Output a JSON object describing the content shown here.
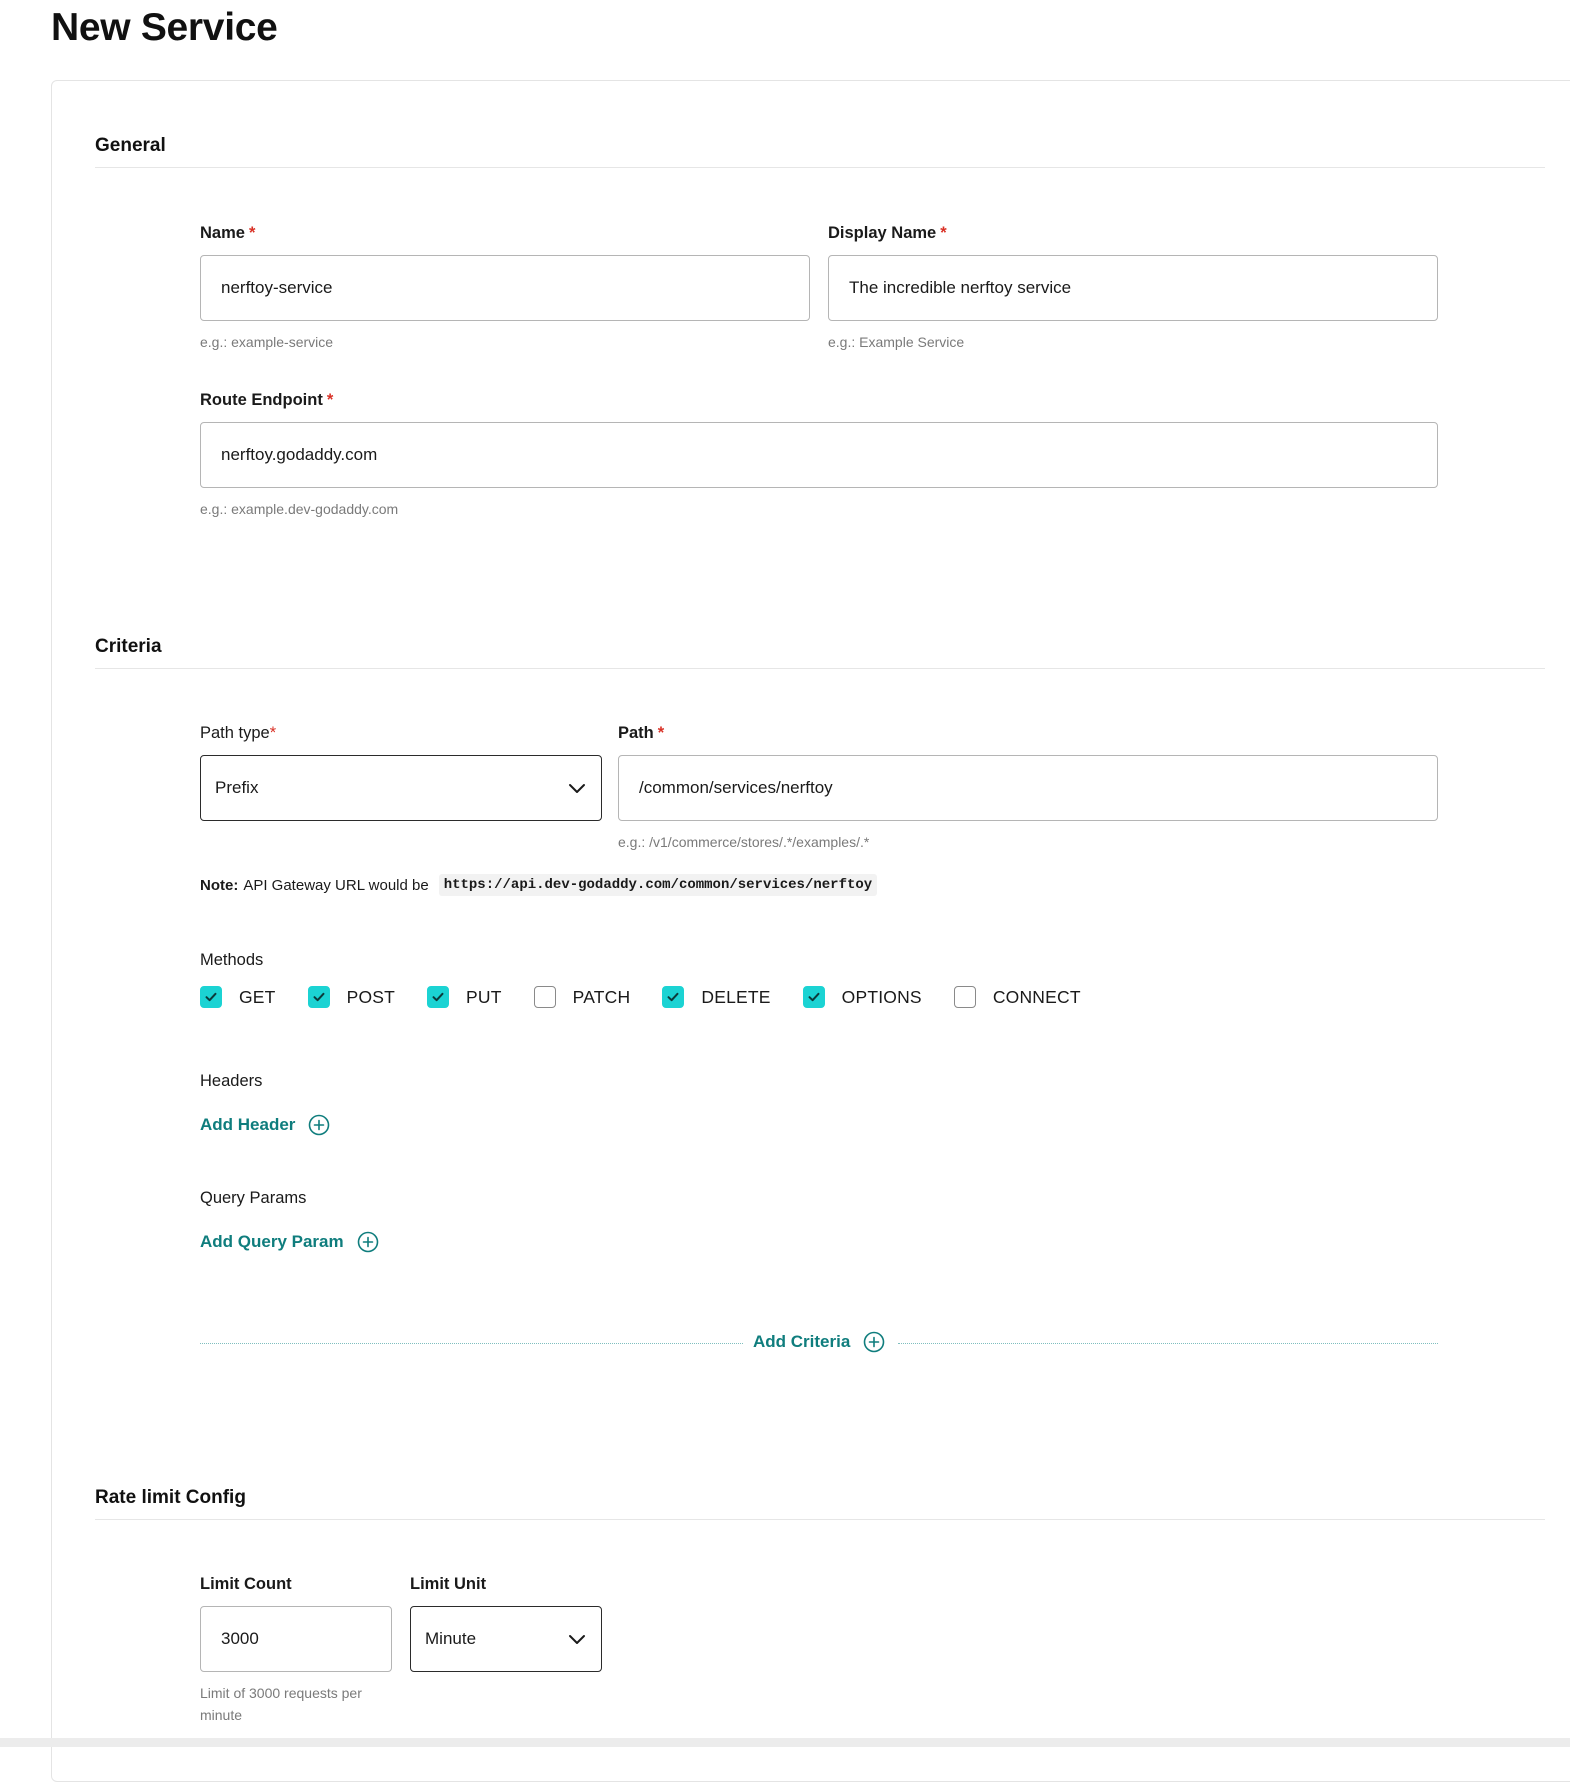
{
  "page": {
    "title": "New Service"
  },
  "general": {
    "section_title": "General",
    "name": {
      "label": "Name",
      "required_mark": "*",
      "value": "nerftoy-service",
      "hint": "e.g.: example-service"
    },
    "display_name": {
      "label": "Display Name",
      "required_mark": "*",
      "value": "The incredible nerftoy service",
      "hint": "e.g.: Example Service"
    },
    "route_endpoint": {
      "label": "Route Endpoint",
      "required_mark": "*",
      "value": "nerftoy.godaddy.com",
      "hint": "e.g.: example.dev-godaddy.com"
    }
  },
  "criteria": {
    "section_title": "Criteria",
    "path_type": {
      "label": "Path type",
      "required_mark": "*",
      "selected": "Prefix"
    },
    "path": {
      "label": "Path",
      "required_mark": "*",
      "value": "/common/services/nerftoy",
      "hint": "e.g.: /v1/commerce/stores/.*/examples/.*"
    },
    "note": {
      "prefix": "Note:",
      "text": "API Gateway URL would be",
      "url": "https://api.dev-godaddy.com/common/services/nerftoy"
    },
    "methods": {
      "label": "Methods",
      "items": [
        {
          "label": "GET",
          "checked": true
        },
        {
          "label": "POST",
          "checked": true
        },
        {
          "label": "PUT",
          "checked": true
        },
        {
          "label": "PATCH",
          "checked": false
        },
        {
          "label": "DELETE",
          "checked": true
        },
        {
          "label": "OPTIONS",
          "checked": true
        },
        {
          "label": "CONNECT",
          "checked": false
        }
      ]
    },
    "headers": {
      "label": "Headers",
      "add_label": "Add Header"
    },
    "query_params": {
      "label": "Query Params",
      "add_label": "Add Query Param"
    },
    "add_criteria_label": "Add Criteria"
  },
  "rate_limit": {
    "section_title": "Rate limit Config",
    "limit_count": {
      "label": "Limit Count",
      "value": "3000",
      "hint": "Limit of 3000 requests per minute"
    },
    "limit_unit": {
      "label": "Limit Unit",
      "selected": "Minute"
    }
  },
  "colors": {
    "accent": "#0f7d7d",
    "checkbox_checked": "#1bd3d3",
    "required": "#d93025"
  },
  "icons": {
    "dropdown": "chevron-down-icon",
    "add": "plus-circle-icon",
    "checked": "check-icon"
  }
}
